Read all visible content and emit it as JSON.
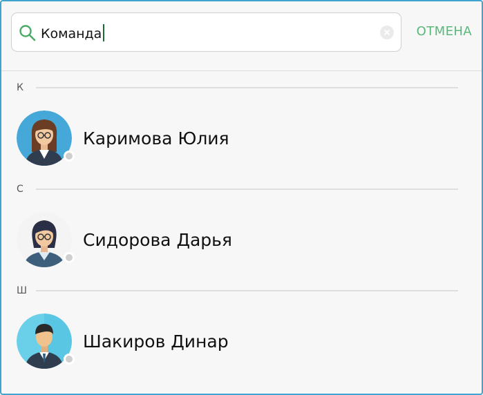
{
  "search": {
    "value": "Команда",
    "cancel_label": "ОТМЕНА"
  },
  "sections": [
    {
      "letter": "К",
      "contact": {
        "name": "Каримова Юлия",
        "avatar": "female-avatar-brown-hair",
        "status": "offline"
      }
    },
    {
      "letter": "С",
      "contact": {
        "name": "Сидорова Дарья",
        "avatar": "female-avatar-short-hair",
        "status": "offline"
      }
    },
    {
      "letter": "Ш",
      "contact": {
        "name": "Шакиров Динар",
        "avatar": "male-avatar",
        "status": "offline"
      }
    }
  ],
  "colors": {
    "accent": "#58b879",
    "caret": "#1f6a33",
    "frame_border": "#3fa3d1",
    "status_offline": "#cfcfcf"
  }
}
